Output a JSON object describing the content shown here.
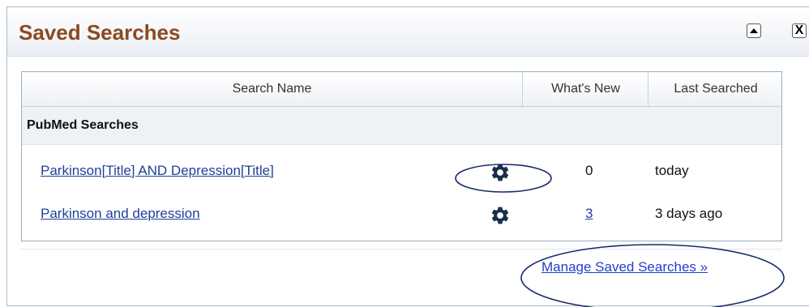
{
  "panel": {
    "title": "Saved Searches",
    "collapse_icon": "triangle-up-icon",
    "close_label": "X"
  },
  "table": {
    "headers": [
      "Search Name",
      "What's New",
      "Last Searched"
    ],
    "group": "PubMed Searches",
    "rows": [
      {
        "name": "Parkinson[Title] AND Depression[Title]",
        "whats_new": "0",
        "whats_new_is_link": false,
        "last_searched": "today",
        "icon": "gear-icon"
      },
      {
        "name": "Parkinson and depression",
        "whats_new": "3",
        "whats_new_is_link": true,
        "last_searched": "3 days ago",
        "icon": "gear-icon"
      }
    ]
  },
  "footer": {
    "manage_link": "Manage Saved Searches »"
  },
  "colors": {
    "title": "#8b4a1f",
    "link": "#1f3f99",
    "annotation": "#1a2a6c"
  }
}
